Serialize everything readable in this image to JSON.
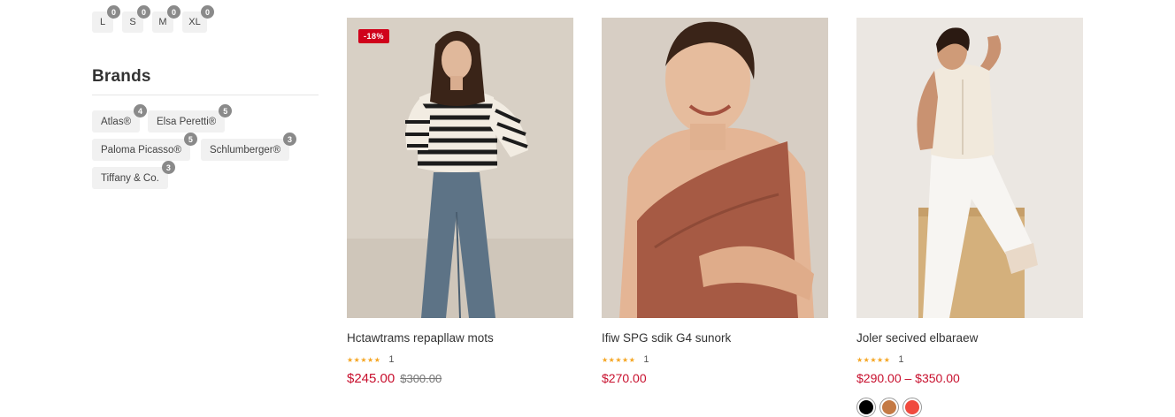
{
  "sizes": [
    {
      "label": "L",
      "count": "0"
    },
    {
      "label": "S",
      "count": "0"
    },
    {
      "label": "M",
      "count": "0"
    },
    {
      "label": "XL",
      "count": "0"
    }
  ],
  "brands": {
    "title": "Brands",
    "items": [
      {
        "label": "Atlas®",
        "count": "4"
      },
      {
        "label": "Elsa Peretti®",
        "count": "5"
      },
      {
        "label": "Paloma Picasso®",
        "count": "5"
      },
      {
        "label": "Schlumberger®",
        "count": "3"
      },
      {
        "label": "Tiffany & Co.",
        "count": "3"
      }
    ]
  },
  "products": [
    {
      "name": "Hctawtrams repapllaw mots",
      "badge": "-18%",
      "stars": "★★★★★",
      "rating_count": "1",
      "price": "$245.00",
      "old_price": "$300.00"
    },
    {
      "name": "Ifiw SPG sdik G4 sunork",
      "stars": "★★★★★",
      "rating_count": "1",
      "price": "$270.00"
    },
    {
      "name": "Joler secived elbaraew",
      "stars": "★★★★★",
      "rating_count": "1",
      "price": "$290.00 – $350.00",
      "swatches": [
        "#000000",
        "#c47a45",
        "#f04a3e"
      ]
    }
  ]
}
